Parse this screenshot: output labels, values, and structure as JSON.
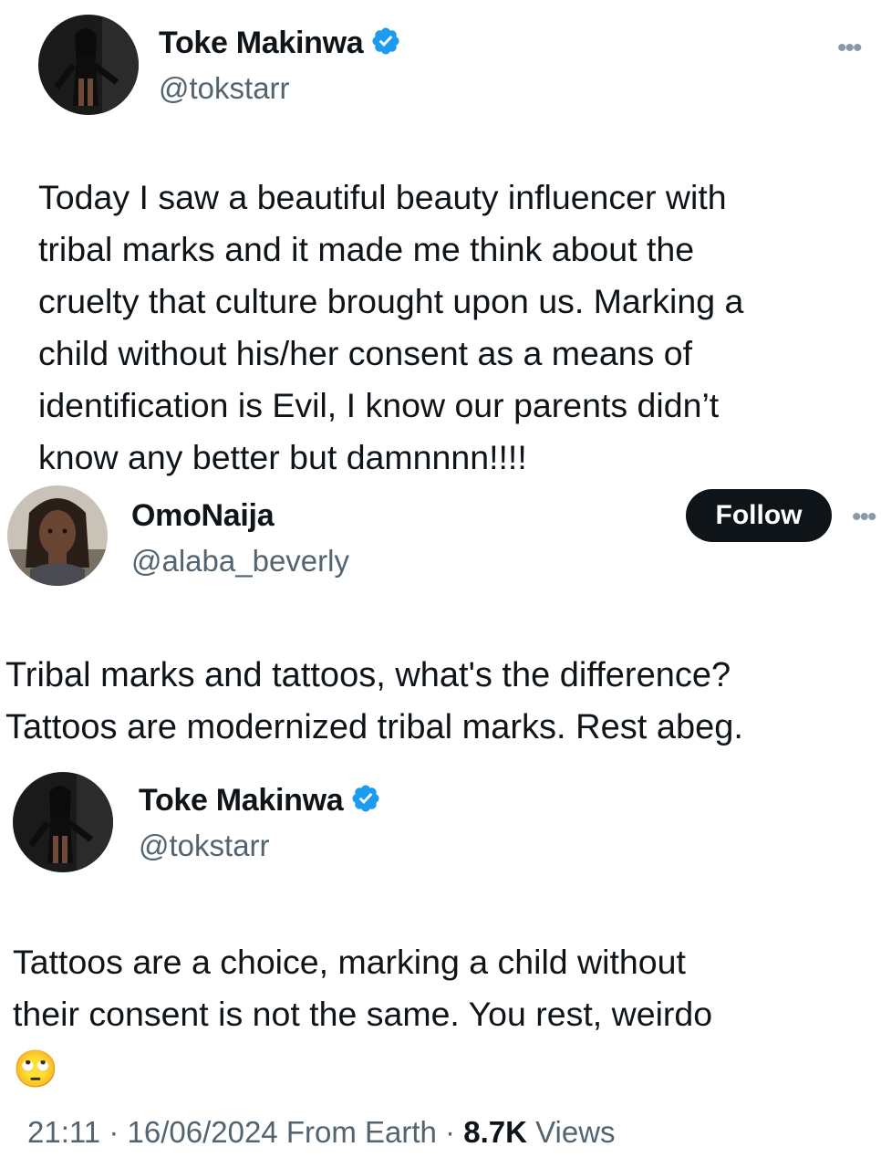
{
  "tweet1": {
    "name": "Toke Makinwa",
    "handle": "@tokstarr",
    "text": "Today I saw a beautiful beauty influencer with\ntribal marks and it made me think about the\ncruelty that culture  brought upon us. Marking a\nchild without his/her consent as a means of\nidentification is Evil, I know our parents didn’t\nknow any better but damnnnn!!!!",
    "more": "•••",
    "verified_icon": "verified-badge-icon"
  },
  "reply": {
    "name": "OmoNaija",
    "handle": "@alaba_beverly",
    "follow_label": "Follow",
    "text": "Tribal marks and tattoos, what's the difference?\nTattoos are modernized tribal marks. Rest abeg.",
    "more": "•••"
  },
  "tweet2": {
    "name": "Toke Makinwa",
    "handle": "@tokstarr",
    "text": "Tattoos are a choice, marking a child without\ntheir consent is not the same. You rest, weirdo",
    "emoji": "🙄",
    "time": "21:11",
    "date": "16/06/2024",
    "source": "From Earth",
    "views_count": "8.7K",
    "views_label": "Views",
    "sep": "·"
  },
  "colors": {
    "text": "#0f1419",
    "secondary": "#536471",
    "verified": "#1d9bf0",
    "button": "#0f1419"
  }
}
